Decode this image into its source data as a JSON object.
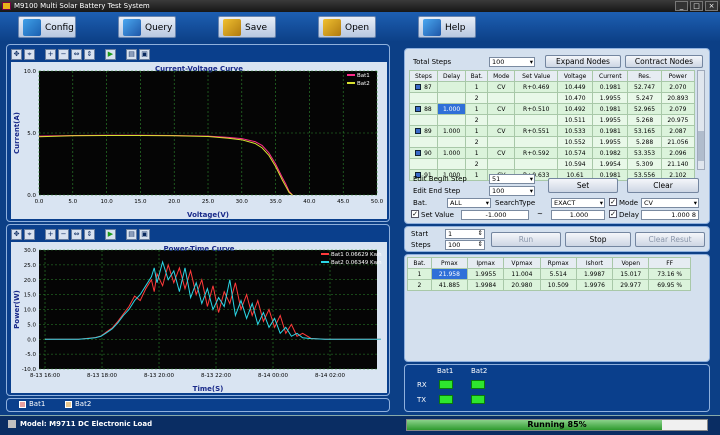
{
  "window": {
    "title": "M9100 Multi Solar Battery Test System"
  },
  "toolbar": {
    "config": "Config",
    "query": "Query",
    "save": "Save",
    "open": "Open",
    "help": "Help"
  },
  "chart_data": [
    {
      "type": "line",
      "title": "Current-Voltage Curve",
      "xlabel": "Voltage(V)",
      "ylabel": "Current(A)",
      "xlim": [
        0,
        50
      ],
      "ylim": [
        0,
        10
      ],
      "xticks": [
        "0.0",
        "5.0",
        "10.0",
        "15.0",
        "20.0",
        "25.0",
        "30.0",
        "35.0",
        "40.0",
        "45.0",
        "50.0"
      ],
      "yticks": [
        "0.0",
        "5.0",
        "10.0"
      ],
      "legend": "top-right",
      "series": [
        {
          "name": "Bat1",
          "color": "#ff2a8a",
          "x": [
            0,
            5,
            10,
            15,
            20,
            25,
            28,
            30,
            32,
            33,
            34,
            35,
            36,
            36.5,
            37,
            37.5
          ],
          "y": [
            4.75,
            4.8,
            4.82,
            4.82,
            4.8,
            4.75,
            4.65,
            4.55,
            4.3,
            4.0,
            3.4,
            2.5,
            1.4,
            0.9,
            0.3,
            0
          ]
        },
        {
          "name": "Bat2",
          "color": "#d8e030",
          "x": [
            0,
            5,
            10,
            15,
            20,
            25,
            28,
            30,
            32,
            33,
            34,
            35,
            36,
            36.5,
            37,
            37.5
          ],
          "y": [
            4.7,
            4.78,
            4.8,
            4.8,
            4.78,
            4.72,
            4.58,
            4.45,
            4.15,
            3.8,
            3.2,
            2.3,
            1.2,
            0.7,
            0.2,
            0
          ]
        }
      ]
    },
    {
      "type": "line",
      "title": "Power-Time Curve",
      "xlabel": "Time(S)",
      "ylabel": "Power(W)",
      "ylim": [
        -10,
        30
      ],
      "xticks": [
        "8-13 16:00",
        "8-13 18:00",
        "8-13 20:00",
        "8-13 22:00",
        "8-14 00:00",
        "8-14 02:00"
      ],
      "yticks": [
        "-10.0",
        "-5.0",
        "0.0",
        "5.0",
        "10.0",
        "15.0",
        "20.0",
        "25.0",
        "30.0"
      ],
      "legend": "top-right",
      "series": [
        {
          "name": "Bat1 0.06629 Kwh",
          "color": "#ff3a3a",
          "x": [
            0,
            1.2,
            1.5,
            1.8,
            2.0,
            2.2,
            2.4,
            2.6,
            2.8,
            3.0,
            3.2,
            3.4,
            3.6,
            3.8,
            3.9,
            4.0,
            4.2,
            4.4,
            4.6,
            4.8,
            5.0,
            5.2,
            5.4,
            5.6,
            5.8,
            6.0,
            6.2,
            6.4,
            6.6,
            6.8,
            7.0,
            7.2,
            7.4,
            7.6,
            7.8,
            8.0,
            8.2,
            8.4,
            8.6,
            8.8,
            9.0,
            9.2,
            9.5,
            10,
            12
          ],
          "y": [
            0,
            0,
            0.3,
            0.6,
            1.1,
            2.5,
            3.8,
            6,
            8.5,
            11,
            14.5,
            13,
            17,
            20,
            16,
            22,
            18,
            25,
            19,
            24,
            17,
            23,
            15,
            20,
            11,
            18,
            9,
            16,
            12,
            19,
            10,
            15,
            8,
            13,
            6,
            10,
            4,
            8,
            2,
            5,
            1,
            2,
            0.3,
            0,
            0
          ]
        },
        {
          "name": "Bat2 0.06349 Kwh",
          "color": "#2ad6e6",
          "x": [
            0,
            1.2,
            1.5,
            1.8,
            2.0,
            2.2,
            2.4,
            2.6,
            2.8,
            3.0,
            3.2,
            3.4,
            3.6,
            3.8,
            3.9,
            4.0,
            4.2,
            4.4,
            4.6,
            4.8,
            5.0,
            5.2,
            5.4,
            5.6,
            5.8,
            6.0,
            6.2,
            6.4,
            6.6,
            6.8,
            7.0,
            7.2,
            7.4,
            7.6,
            7.8,
            8.0,
            8.2,
            8.4,
            8.6,
            8.8,
            9.0,
            9.2,
            9.5,
            10,
            12
          ],
          "y": [
            0,
            0,
            0.2,
            0.5,
            1.0,
            2.2,
            3.5,
            5.5,
            8,
            10,
            13,
            15,
            18,
            21,
            24,
            19,
            26,
            20,
            23,
            16,
            24,
            14,
            19,
            12,
            17,
            10,
            14,
            11,
            20,
            8,
            13,
            7,
            12,
            5,
            9,
            4,
            7,
            2,
            4,
            1,
            2,
            0.5,
            0.2,
            0,
            0
          ]
        }
      ]
    }
  ],
  "chart_legend": {
    "bat1": "Bat1",
    "bat2": "Bat2"
  },
  "right": {
    "total_steps_label": "Total Steps",
    "total_steps_value": "100",
    "expand_nodes": "Expand Nodes",
    "contract_nodes": "Contract Nodes",
    "table_headers": [
      "Steps",
      "Delay",
      "Bat.",
      "Mode",
      "Set Value",
      "Voltage",
      "Current",
      "Res.",
      "Power"
    ],
    "rows": [
      [
        "87",
        "",
        "1",
        "CV",
        "R+0.469",
        "10.449",
        "0.1981",
        "52.747",
        "2.070"
      ],
      [
        "",
        "",
        "2",
        "",
        "",
        "10.470",
        "1.9955",
        "5.247",
        "20.893"
      ],
      [
        "88",
        "1.000",
        "1",
        "CV",
        "R+0.510",
        "10.492",
        "0.1981",
        "52.965",
        "2.079"
      ],
      [
        "",
        "",
        "2",
        "",
        "",
        "10.511",
        "1.9955",
        "5.268",
        "20.975"
      ],
      [
        "89",
        "1.000",
        "1",
        "CV",
        "R+0.551",
        "10.533",
        "0.1981",
        "53.165",
        "2.087"
      ],
      [
        "",
        "",
        "2",
        "",
        "",
        "10.552",
        "1.9955",
        "5.288",
        "21.056"
      ],
      [
        "90",
        "1.000",
        "1",
        "CV",
        "R+0.592",
        "10.574",
        "0.1982",
        "53.353",
        "2.096"
      ],
      [
        "",
        "",
        "2",
        "",
        "",
        "10.594",
        "1.9954",
        "5.309",
        "21.140"
      ],
      [
        "91",
        "1.000",
        "1",
        "CV",
        "R+0.633",
        "10.61",
        "0.1981",
        "53.556",
        "2.102"
      ]
    ],
    "edit_begin_label": "Edit Begin Step",
    "edit_begin_value": "51",
    "edit_end_label": "Edit End Step",
    "edit_end_value": "100",
    "set": "Set",
    "clear": "Clear",
    "bat_label": "Bat.",
    "bat_value": "ALL",
    "search_label": "SearchType",
    "search_value": "EXACT",
    "mode_label": "Mode",
    "mode_value": "CV",
    "set_value_label": "Set Value",
    "set_value_value": "-1.000",
    "tilde": "~",
    "set_value_to": "1.000",
    "delay_label": "Delay",
    "delay_value": "1.000 8",
    "start_label": "Start",
    "start_value": "1",
    "steps_label": "Steps",
    "steps_value": "100",
    "run": "Run",
    "stop": "Stop",
    "clear_result": "Clear Resut",
    "result_headers": [
      "Bat.",
      "Pmax",
      "Ipmax",
      "Vpmax",
      "Rpmax",
      "Ishort",
      "Vopen",
      "FF"
    ],
    "results": [
      [
        "1",
        "21.958",
        "1.9955",
        "11.004",
        "5.514",
        "1.9987",
        "15.017",
        "73.16 %"
      ],
      [
        "2",
        "41.885",
        "1.9984",
        "20.980",
        "10.509",
        "1.9976",
        "29.977",
        "69.95 %"
      ]
    ],
    "led_bat1": "Bat1",
    "led_bat2": "Bat2",
    "rx": "RX",
    "tx": "TX"
  },
  "bottom_legend": {
    "bat1": "Bat1",
    "bat2": "Bat2"
  },
  "status": {
    "model": "Model: M9711 DC Electronic Load",
    "progress_text": "Running 85%",
    "progress": 0.85
  }
}
